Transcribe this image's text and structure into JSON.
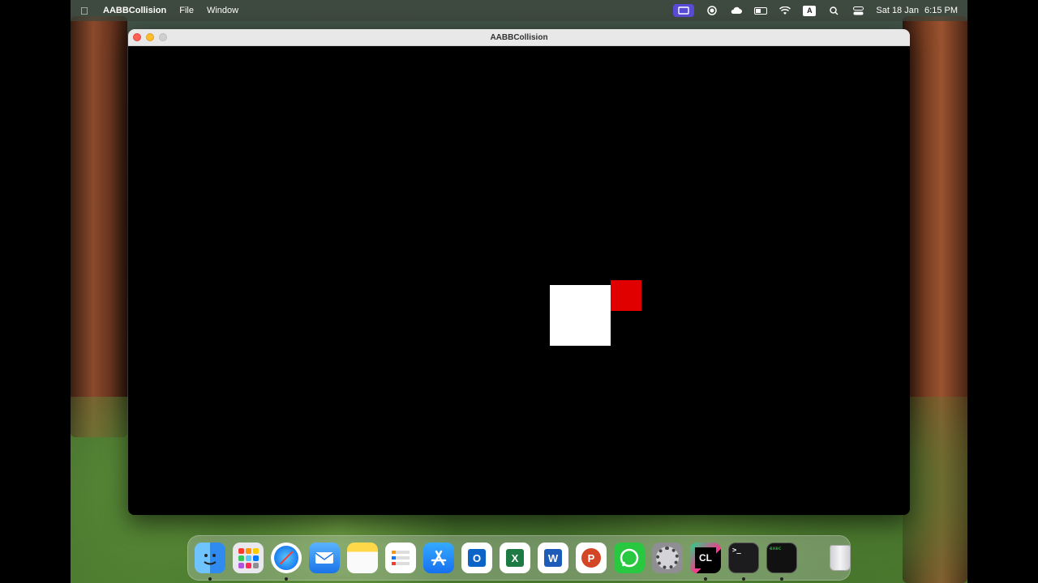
{
  "menubar": {
    "app_name": "AABBCollision",
    "menus": [
      "File",
      "Window"
    ],
    "status": {
      "input_source": "A",
      "date": "Sat 18 Jan",
      "time": "6:15 PM"
    }
  },
  "window": {
    "title": "AABBCollision"
  },
  "scene": {
    "colors": {
      "background": "#000000",
      "player_box": "#ffffff",
      "target_box": "#e00000"
    }
  },
  "dock": {
    "apps": [
      {
        "name": "finder-icon",
        "running": true
      },
      {
        "name": "launchpad-icon",
        "running": false
      },
      {
        "name": "safari-icon",
        "running": true
      },
      {
        "name": "mail-icon",
        "running": false
      },
      {
        "name": "notes-icon",
        "running": false
      },
      {
        "name": "reminders-icon",
        "running": false
      },
      {
        "name": "app-store-icon",
        "running": false
      },
      {
        "name": "outlook-icon",
        "running": false
      },
      {
        "name": "excel-icon",
        "running": false
      },
      {
        "name": "word-icon",
        "running": false
      },
      {
        "name": "powerpoint-icon",
        "running": false
      },
      {
        "name": "whatsapp-icon",
        "running": false
      },
      {
        "name": "system-settings-icon",
        "running": false
      },
      {
        "name": "clion-icon",
        "running": true
      },
      {
        "name": "terminal-icon",
        "running": true
      },
      {
        "name": "exec-icon",
        "running": true
      },
      {
        "name": "trash-icon",
        "running": false
      }
    ],
    "labels": {
      "clion": "CL",
      "terminal": ">_",
      "exec": "exec",
      "outlook": "O",
      "excel": "X",
      "word": "W",
      "powerpoint": "P"
    }
  }
}
